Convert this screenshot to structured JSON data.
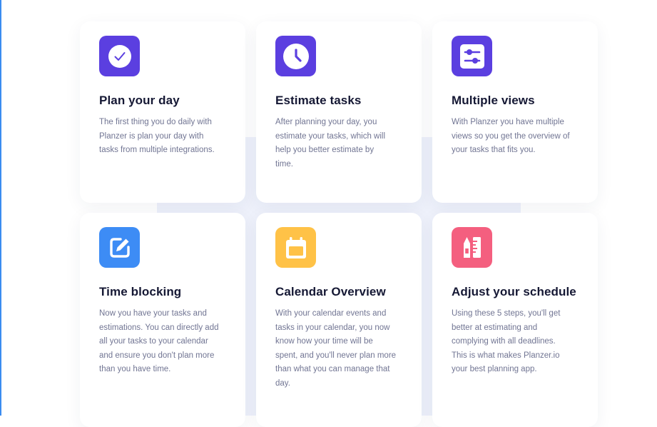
{
  "colors": {
    "purple": "#5b3fe0",
    "blue": "#3d8cf5",
    "yellow": "#ffc247",
    "pink": "#f45f7f",
    "title": "#151834",
    "body": "#717593",
    "backdrop": "#eef1fb"
  },
  "features": [
    {
      "title": "Plan your day",
      "icon": "check-circle-icon",
      "lines": [
        "The first thing you do daily with",
        "Planzer is plan your day with",
        "tasks from multiple integrations."
      ]
    },
    {
      "title": "Estimate tasks",
      "icon": "clock-icon",
      "lines": [
        "After planning your day, you",
        "estimate your tasks, which will",
        "help you better estimate by",
        "time."
      ]
    },
    {
      "title": "Multiple views",
      "icon": "sliders-icon",
      "lines": [
        "With Planzer you have multiple",
        "views so you get the overview of",
        "your tasks that fits you."
      ]
    },
    {
      "title": "Time blocking",
      "icon": "edit-pencil-icon",
      "lines": [
        "Now you have your tasks and",
        "estimations. You can directly add",
        "all your tasks to your calendar",
        "and ensure you don't plan more",
        "than you have time."
      ]
    },
    {
      "title": "Calendar Overview",
      "icon": "calendar-icon",
      "lines": [
        "With your calendar events and",
        "tasks in your calendar, you now",
        "know how your time will be",
        "spent, and you'll never plan more",
        "than what you can manage that",
        "day."
      ]
    },
    {
      "title": "Adjust your schedule",
      "icon": "ruler-pencil-icon",
      "lines": [
        "Using these 5 steps, you'll get",
        "better at estimating and",
        "complying with all deadlines.",
        "This is what makes Planzer.io",
        "your best planning app."
      ]
    }
  ]
}
